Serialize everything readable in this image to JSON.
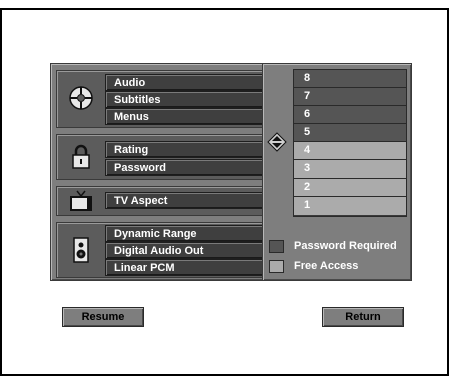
{
  "colors": {
    "panel": "#7e7e7e",
    "button": "#3f3f3f",
    "selected_rows": "#ababab",
    "unselected_rows": "#555555",
    "password_required": "#555555",
    "free_access": "#ababab"
  },
  "menu": {
    "groups": [
      {
        "icon": "disc-icon",
        "items": [
          {
            "label": "Audio"
          },
          {
            "label": "Subtitles"
          },
          {
            "label": "Menus"
          }
        ]
      },
      {
        "icon": "padlock-icon",
        "items": [
          {
            "label": "Rating",
            "has_submenu": true
          },
          {
            "label": "Password"
          }
        ]
      },
      {
        "icon": "tv-icon",
        "items": [
          {
            "label": "TV Aspect"
          }
        ]
      },
      {
        "icon": "speaker-icon",
        "items": [
          {
            "label": "Dynamic Range"
          },
          {
            "label": "Digital Audio Out"
          },
          {
            "label": "Linear PCM"
          }
        ]
      }
    ]
  },
  "rating": {
    "scroll_icon": "up-down-arrow-icon",
    "levels": [
      {
        "label": "8",
        "state": "password-required"
      },
      {
        "label": "7",
        "state": "password-required"
      },
      {
        "label": "6",
        "state": "password-required"
      },
      {
        "label": "5",
        "state": "password-required"
      },
      {
        "label": "4",
        "state": "free-access"
      },
      {
        "label": "3",
        "state": "free-access"
      },
      {
        "label": "2",
        "state": "free-access"
      },
      {
        "label": "1",
        "state": "free-access"
      }
    ],
    "legend": {
      "password_required": "Password Required",
      "free_access": "Free Access"
    }
  },
  "buttons": {
    "resume": "Resume",
    "return": "Return"
  }
}
